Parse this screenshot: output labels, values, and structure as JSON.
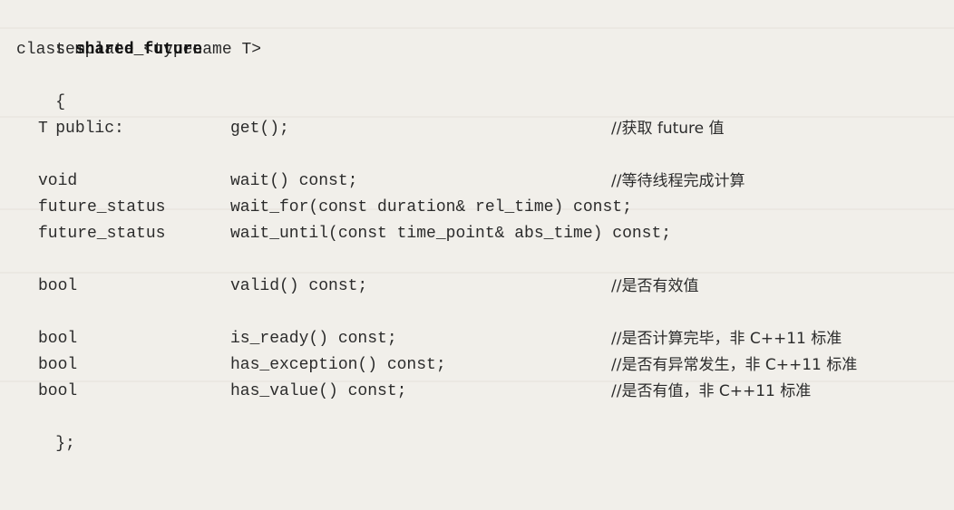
{
  "code": {
    "template_line": "template <typename T>",
    "class_keyword": "class ",
    "class_name": "shared_future",
    "open_brace": "{",
    "access": "public:",
    "members": [
      {
        "type": "T",
        "func": "get();",
        "comment": "//获取 future 值"
      },
      {
        "type": "void",
        "func": "wait() const;",
        "comment": "//等待线程完成计算"
      },
      {
        "type": "future_status",
        "func": "wait_for(const duration& rel_time) const;",
        "comment": ""
      },
      {
        "type": "future_status",
        "func": "wait_until(const time_point& abs_time) const;",
        "comment": ""
      },
      {
        "type": "bool",
        "func": "valid() const;",
        "comment": "//是否有效值"
      },
      {
        "type": "bool",
        "func": "is_ready() const;",
        "comment": "//是否计算完毕，非 C++11 标准"
      },
      {
        "type": "bool",
        "func": "has_exception() const;",
        "comment": "//是否有异常发生，非 C++11 标准"
      },
      {
        "type": "bool",
        "func": "has_value() const;",
        "comment": "//是否有值，非 C++11 标准"
      }
    ],
    "close_brace": "};"
  }
}
